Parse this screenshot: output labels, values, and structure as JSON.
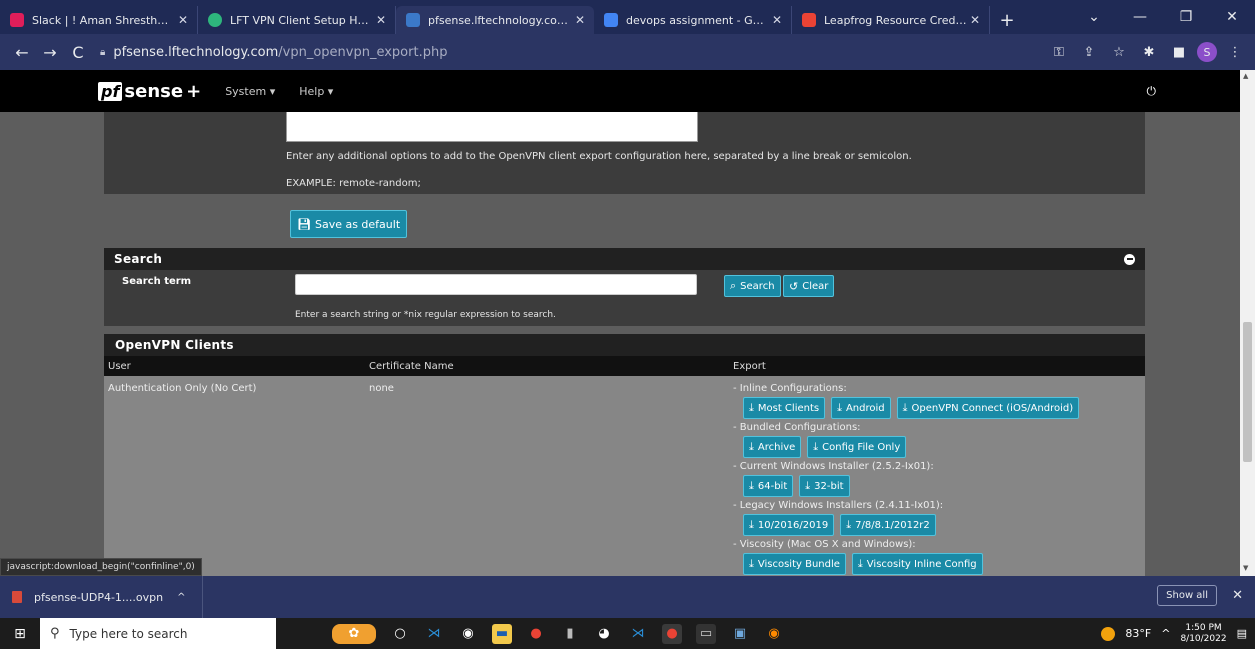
{
  "browser": {
    "tabs": [
      {
        "title": "Slack | ! Aman Shrestha | Lea",
        "favicon_color": "#e01e5a"
      },
      {
        "title": "LFT VPN Client Setup How-To",
        "favicon_color": "#2eb67d"
      },
      {
        "title": "pfsense.lftechnology.com - C",
        "favicon_color": "#3b79c9",
        "active": true
      },
      {
        "title": "devops assignment - Google",
        "favicon_color": "#4285f4"
      },
      {
        "title": "Leapfrog Resource Credentia",
        "favicon_color": "#ea4335"
      }
    ],
    "new_tab_label": "+",
    "url_host": "pfsense.lftechnology.com",
    "url_path": "/vpn_openvpn_export.php",
    "profile_initial": "S",
    "status_url": "javascript:download_begin(\"confinline\",0)"
  },
  "pfsense": {
    "logo_text": "sense",
    "logo_prefix": "pf",
    "logo_suffix": "+",
    "menu_system": "System ▾",
    "menu_help": "Help ▾"
  },
  "advanced": {
    "hint": "Enter any additional options to add to the OpenVPN client export configuration here, separated by a line break or semicolon.",
    "example": "EXAMPLE: remote-random;",
    "save_label": "Save as default"
  },
  "search": {
    "title": "Search",
    "term_label": "Search term",
    "input_value": "",
    "hint": "Enter a search string or *nix regular expression to search.",
    "search_label": "Search",
    "clear_label": "Clear"
  },
  "clients": {
    "title": "OpenVPN Clients",
    "columns": [
      "User",
      "Certificate Name",
      "Export"
    ],
    "row": {
      "user": "Authentication Only (No Cert)",
      "cert": "none",
      "groups": [
        {
          "label": "- Inline Configurations:",
          "buttons": [
            "Most Clients",
            "Android",
            "OpenVPN Connect (iOS/Android)"
          ]
        },
        {
          "label": "- Bundled Configurations:",
          "buttons": [
            "Archive",
            "Config File Only"
          ]
        },
        {
          "label": "- Current Windows Installer (2.5.2-Ix01):",
          "buttons": [
            "64-bit",
            "32-bit"
          ]
        },
        {
          "label": "- Legacy Windows Installers (2.4.11-Ix01):",
          "buttons": [
            "10/2016/2019",
            "7/8/8.1/2012r2"
          ]
        },
        {
          "label": "- Viscosity (Mac OS X and Windows):",
          "buttons": [
            "Viscosity Bundle",
            "Viscosity Inline Config"
          ]
        }
      ]
    }
  },
  "downloads": {
    "file": "pfsense-UDP4-1....ovpn",
    "show_all": "Show all"
  },
  "taskbar": {
    "search_placeholder": "Type here to search",
    "temperature": "83°F",
    "time": "1:50 PM",
    "date": "8/10/2022"
  }
}
